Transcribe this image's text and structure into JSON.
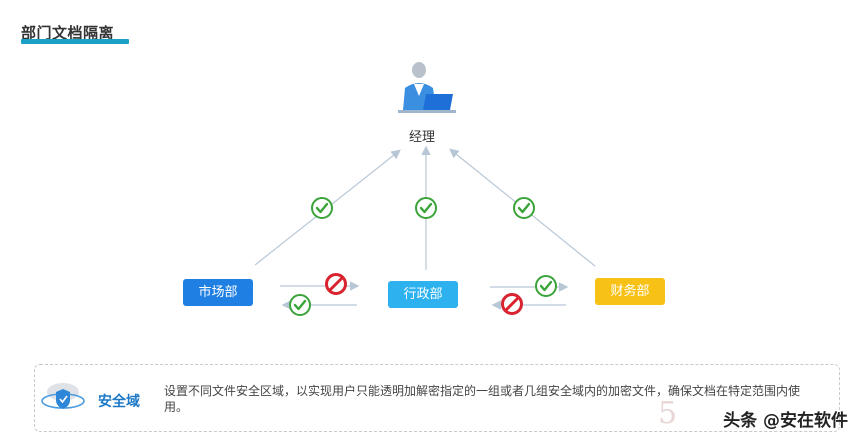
{
  "page_title": "部门文档隔离",
  "nodes": {
    "manager": "经理",
    "market": "市场部",
    "admin": "行政部",
    "finance": "财务部"
  },
  "colors": {
    "market": "#1f7fe3",
    "admin": "#2db1ef",
    "finance": "#f8c116",
    "allow": "#3aa33a",
    "deny": "#d9232e",
    "accent": "#1aa0c4"
  },
  "icons": {
    "manager": "manager-at-laptop-icon",
    "allow": "check-circle-icon",
    "deny": "prohibited-icon",
    "security": "shield-icon"
  },
  "footer": {
    "title": "安全域",
    "description": "设置不同文件安全区域，以实现用户只能透明加解密指定的一组或者几组安全域内的加密文件，确保文档在特定范围内使用。"
  },
  "watermark": "5",
  "credit": "头条 @安在软件"
}
